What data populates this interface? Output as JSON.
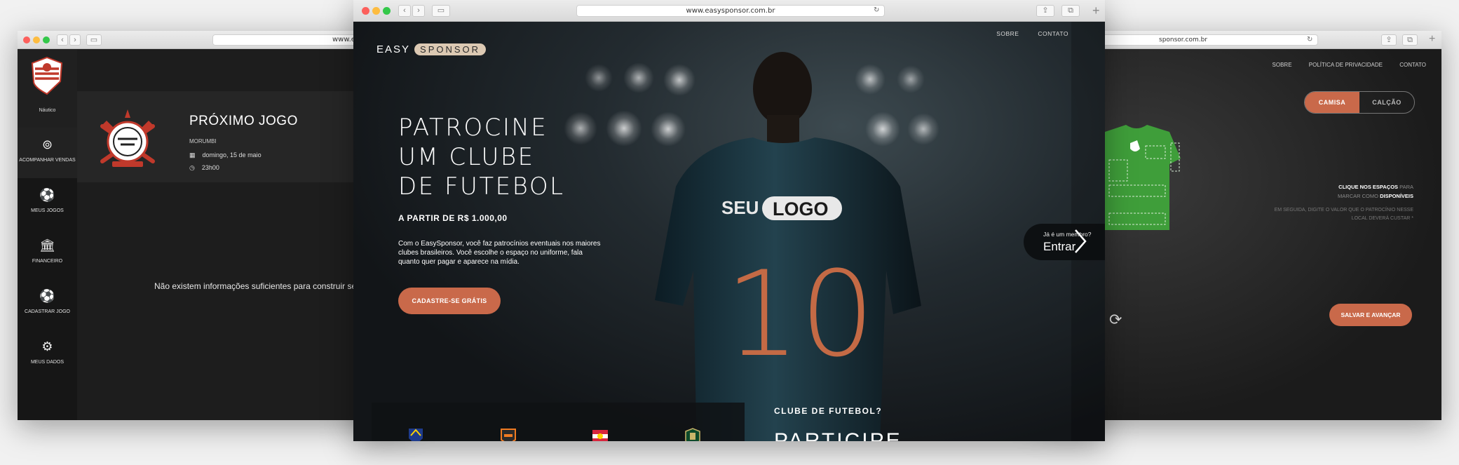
{
  "left_window": {
    "url": "www.easyspons",
    "club_name": "Náutico",
    "sidebar": [
      {
        "label": "ACOMPANHAR VENDAS",
        "icon": "coin-icon",
        "active": true
      },
      {
        "label": "MEUS JOGOS",
        "icon": "ball-icon",
        "active": false
      },
      {
        "label": "FINANCEIRO",
        "icon": "bank-icon",
        "active": false
      },
      {
        "label": "CADASTRAR JOGO",
        "icon": "ball-add-icon",
        "active": false
      },
      {
        "label": "MEUS DADOS",
        "icon": "gears-icon",
        "active": false
      }
    ],
    "next_game": {
      "title": "PRÓXIMO JOGO",
      "venue": "MORUMBI",
      "date": "domingo, 15 de maio",
      "time": "23h00"
    },
    "empty_message": "Não existem informações suficientes para construir seu"
  },
  "center_window": {
    "url": "www.easysponsor.com.br",
    "logo_easy": "EASY",
    "logo_sponsor": "SPONSOR",
    "nav": [
      "SOBRE",
      "CONTATO"
    ],
    "headline": [
      "PATROCINE",
      "UM CLUBE",
      "DE FUTEBOL"
    ],
    "price": "A PARTIR DE R$ 1.000,00",
    "description": "Com o EasySponsor, você faz patrocínios eventuais nos maiores clubes brasileiros. Você escolhe o espaço no uniforme, fala quanto quer pagar e aparece na mídia.",
    "cta": "CADASTRE-SE GRÁTIS",
    "jersey_logo_seu": "SEU",
    "jersey_logo_logo": "LOGO",
    "jersey_number": "10",
    "member_question": "Já é um membro?",
    "member_action": "Entrar",
    "club_question": "CLUBE DE FUTEBOL?",
    "participate": "PARTICIPE"
  },
  "right_window": {
    "url": "sponsor.com.br",
    "nav": [
      "SOBRE",
      "POLÍTICA DE PRIVACIDADE",
      "CONTATO"
    ],
    "toggle": [
      "CAMISA",
      "CALÇÃO"
    ],
    "hint_bold_1": "CLIQUE NOS ESPAÇOS",
    "hint_dim_1": "PARA",
    "hint_dim_2": "MARCAR COMO",
    "hint_bold_2": "DISPONÍVEIS",
    "hint_secondary": "EM SEGUIDA, DIGITE O VALOR QUE O PATROCÍNIO NESSE LOCAL DEVERÁ CUSTAR *",
    "save_button": "SALVAR E AVANÇAR"
  },
  "colors": {
    "accent": "#c9694a",
    "dark_bg": "#1d1d1d",
    "shirt_green": "#3f9e3a",
    "logo_pill": "#dcc9b3"
  }
}
